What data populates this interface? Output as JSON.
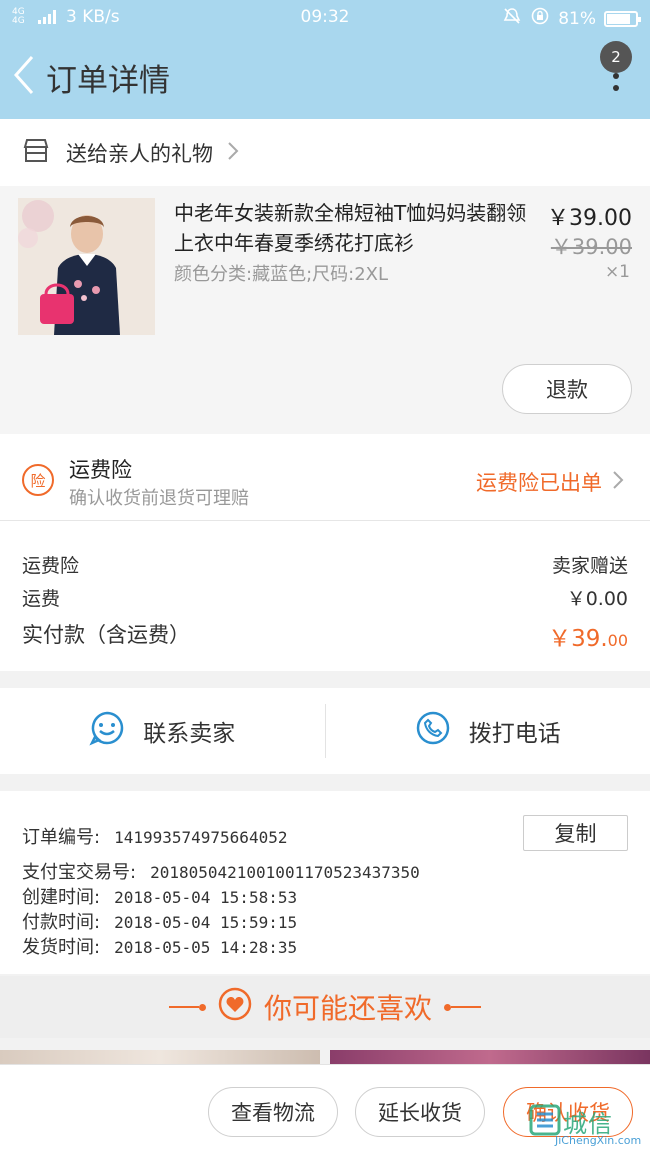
{
  "statusbar": {
    "network": "4G 4G",
    "speed": "3 KB/s",
    "time": "09:32",
    "battery": "81%",
    "battery_level": 0.81
  },
  "header": {
    "title": "订单详情",
    "badge_count": "2"
  },
  "shop": {
    "name": "送给亲人的礼物"
  },
  "product": {
    "name": "中老年女装新款全棉短袖T恤妈妈装翻领上衣中年春夏季绣花打底衫",
    "sku": "颜色分类:藏蓝色;尺码:2XL",
    "price": "￥39.00",
    "original_price": "￥39.00",
    "quantity": "×1",
    "refund_label": "退款"
  },
  "insurance": {
    "icon_text": "险",
    "title": "运费险",
    "subtitle": "确认收货前退货可理赔",
    "status": "运费险已出单"
  },
  "fees": {
    "rows": [
      {
        "label": "运费险",
        "value": "卖家赠送"
      },
      {
        "label": "运费",
        "value": "￥0.00"
      }
    ],
    "total_label": "实付款（含运费）",
    "total_value_main": "￥39.",
    "total_value_cents": "00"
  },
  "contact": {
    "seller_label": "联系卖家",
    "phone_label": "拨打电话"
  },
  "order_info": {
    "copy_label": "复制",
    "lines": [
      {
        "label": "订单编号:",
        "value": "141993574975664052"
      },
      {
        "label": "支付宝交易号:",
        "value": "2018050421001001170523437350"
      },
      {
        "label": "创建时间:",
        "value": "2018-05-04 15:58:53"
      },
      {
        "label": "付款时间:",
        "value": "2018-05-04 15:59:15"
      },
      {
        "label": "发货时间:",
        "value": "2018-05-05 14:28:35"
      }
    ]
  },
  "recommend": {
    "title": "你可能还喜欢"
  },
  "bottom_actions": {
    "logistics": "查看物流",
    "extend": "延长收货",
    "confirm": "确认收货"
  },
  "watermark": {
    "main": "城信",
    "sub": "JiChengXin.com"
  },
  "colors": {
    "accent": "#f06a2a",
    "header_bg": "#a9d7ee",
    "icon_blue": "#2a8fcf"
  },
  "icons": [
    "back-arrow-icon",
    "more-dots-icon",
    "shop-icon",
    "chevron-right-icon",
    "insurance-icon",
    "chat-face-icon",
    "phone-icon",
    "heart-icon"
  ]
}
